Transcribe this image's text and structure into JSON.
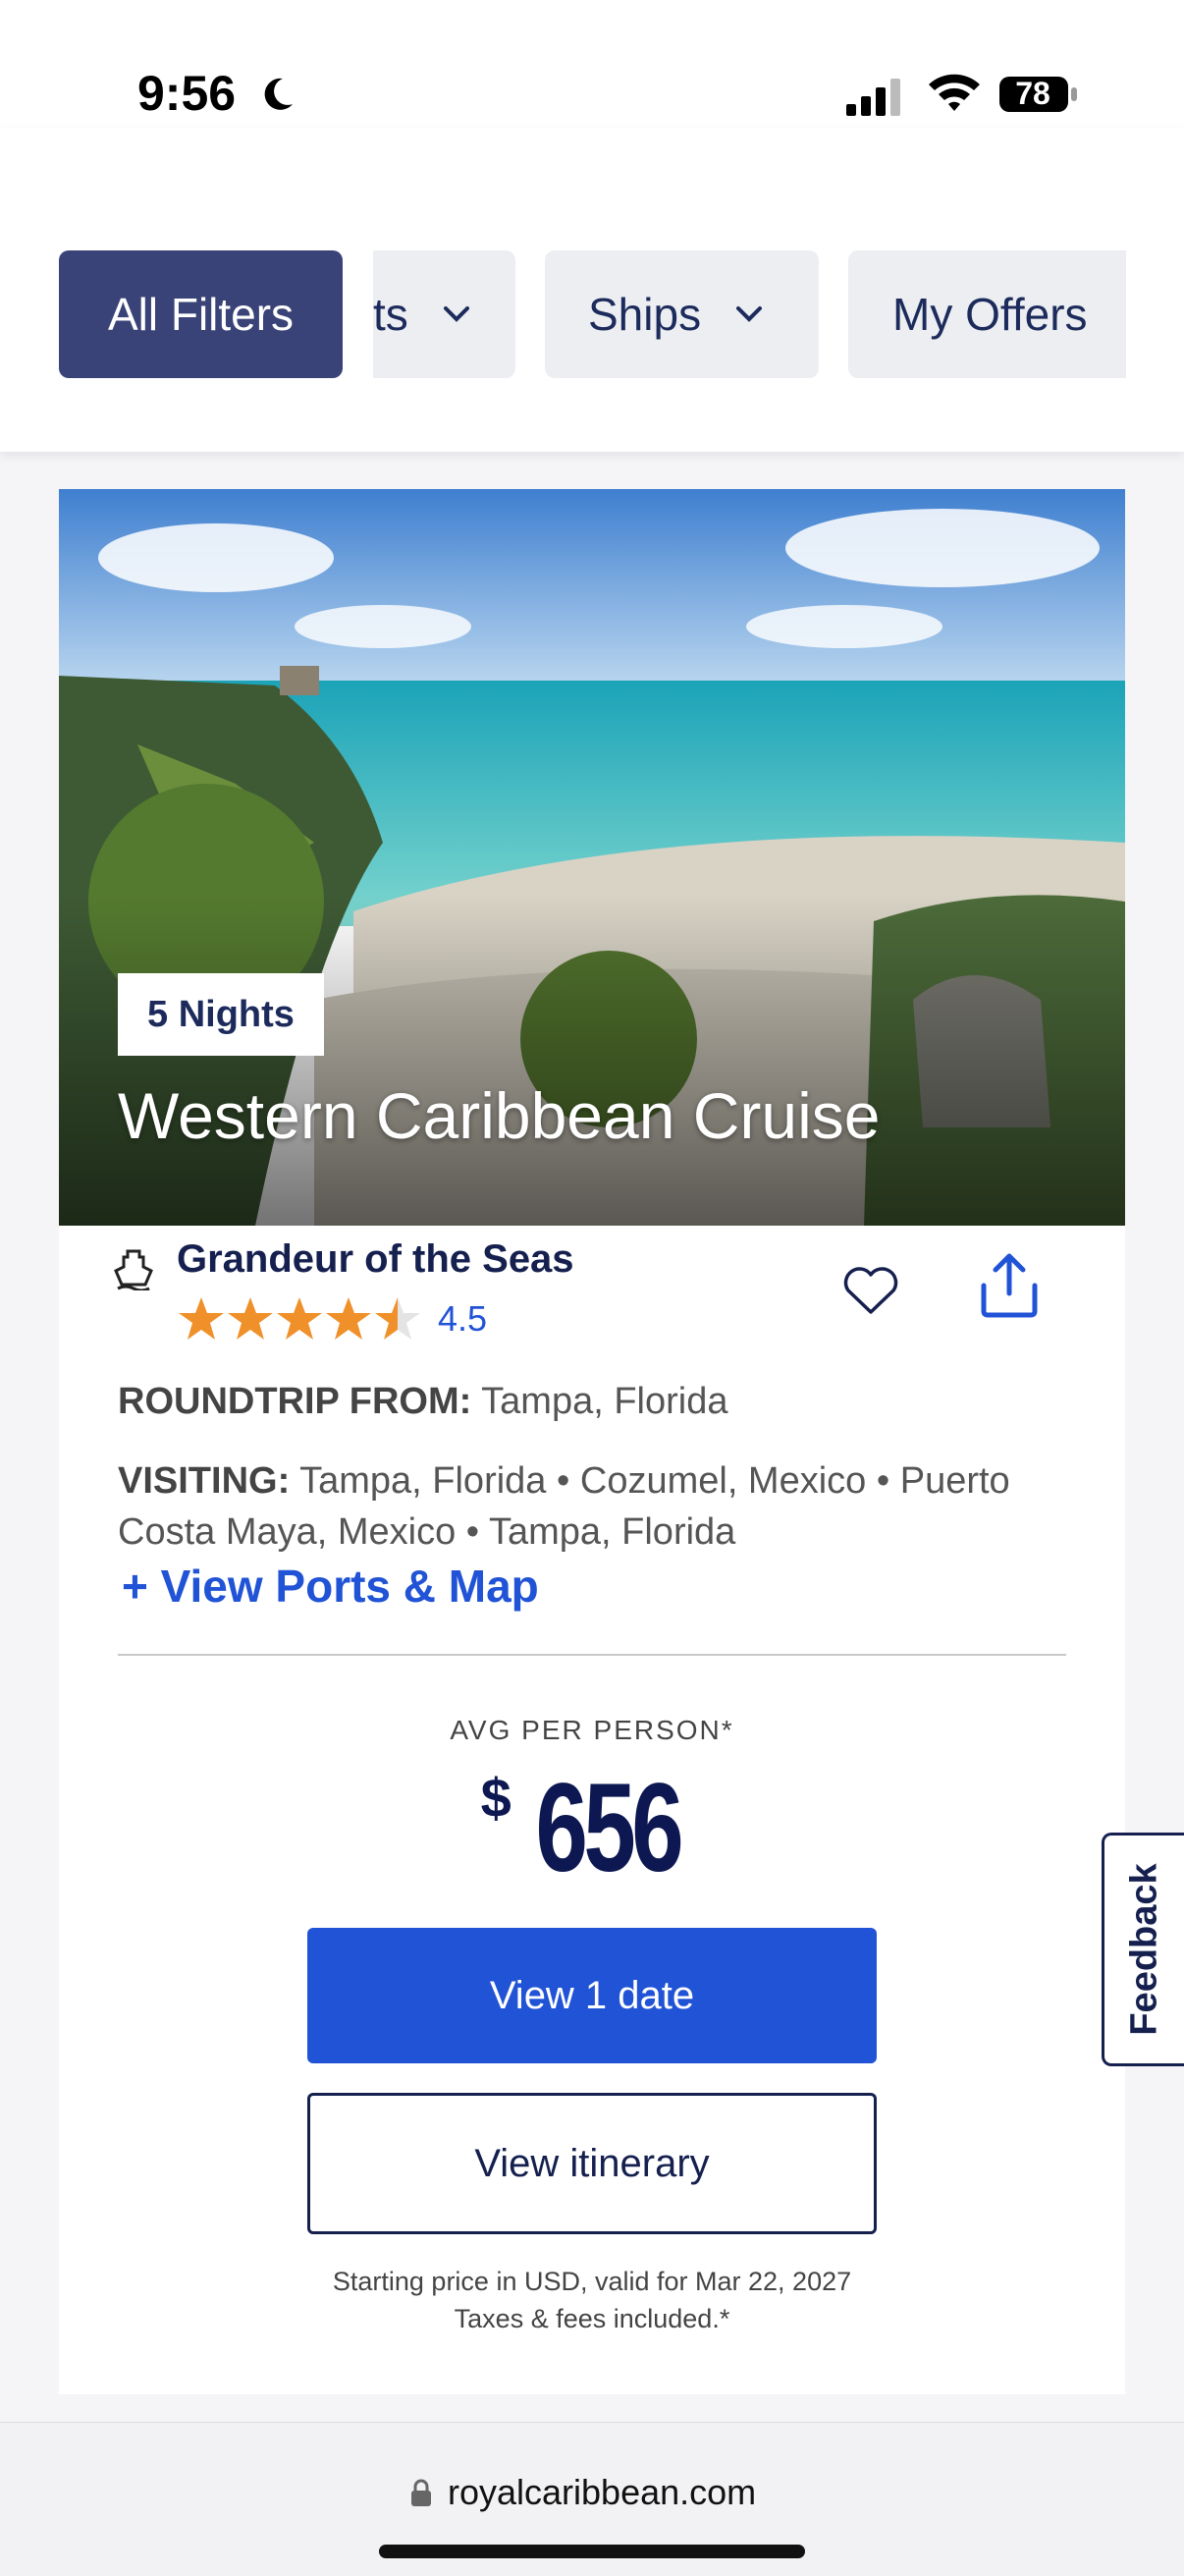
{
  "status_bar": {
    "time": "9:56",
    "battery": "78"
  },
  "filters": {
    "all_filters": "All Filters",
    "partial_chip": "ts",
    "ships": "Ships",
    "my_offers": "My Offers"
  },
  "card": {
    "nights": "5 Nights",
    "title": "Western Caribbean Cruise",
    "ship_name": "Grandeur of the Seas",
    "rating": "4.5",
    "rating_value": 4.5,
    "rating_max": 5,
    "roundtrip_label": "ROUNDTRIP FROM:",
    "roundtrip_value": "Tampa, Florida",
    "visiting_label": "VISITING:",
    "visiting_ports": [
      "Tampa, Florida",
      "Cozumel, Mexico",
      "Puerto Costa Maya, Mexico",
      "Tampa, Florida"
    ],
    "visiting_separator": "•",
    "view_ports_link": "+ View Ports & Map",
    "avg_label": "AVG PER PERSON*",
    "price_currency": "$",
    "price_amount": "656",
    "view_dates_button": "View 1 date",
    "view_itinerary_button": "View itinerary",
    "fine_print_line1": "Starting price in USD, valid for Mar 22, 2027",
    "fine_print_line2": "Taxes & fees included.*"
  },
  "feedback_tab": "Feedback",
  "browser": {
    "url": "royalcaribbean.com"
  },
  "colors": {
    "brand_navy": "#15204f",
    "accent_blue": "#2153d6",
    "filter_active": "#3a4378",
    "star_orange": "#f0902a"
  }
}
